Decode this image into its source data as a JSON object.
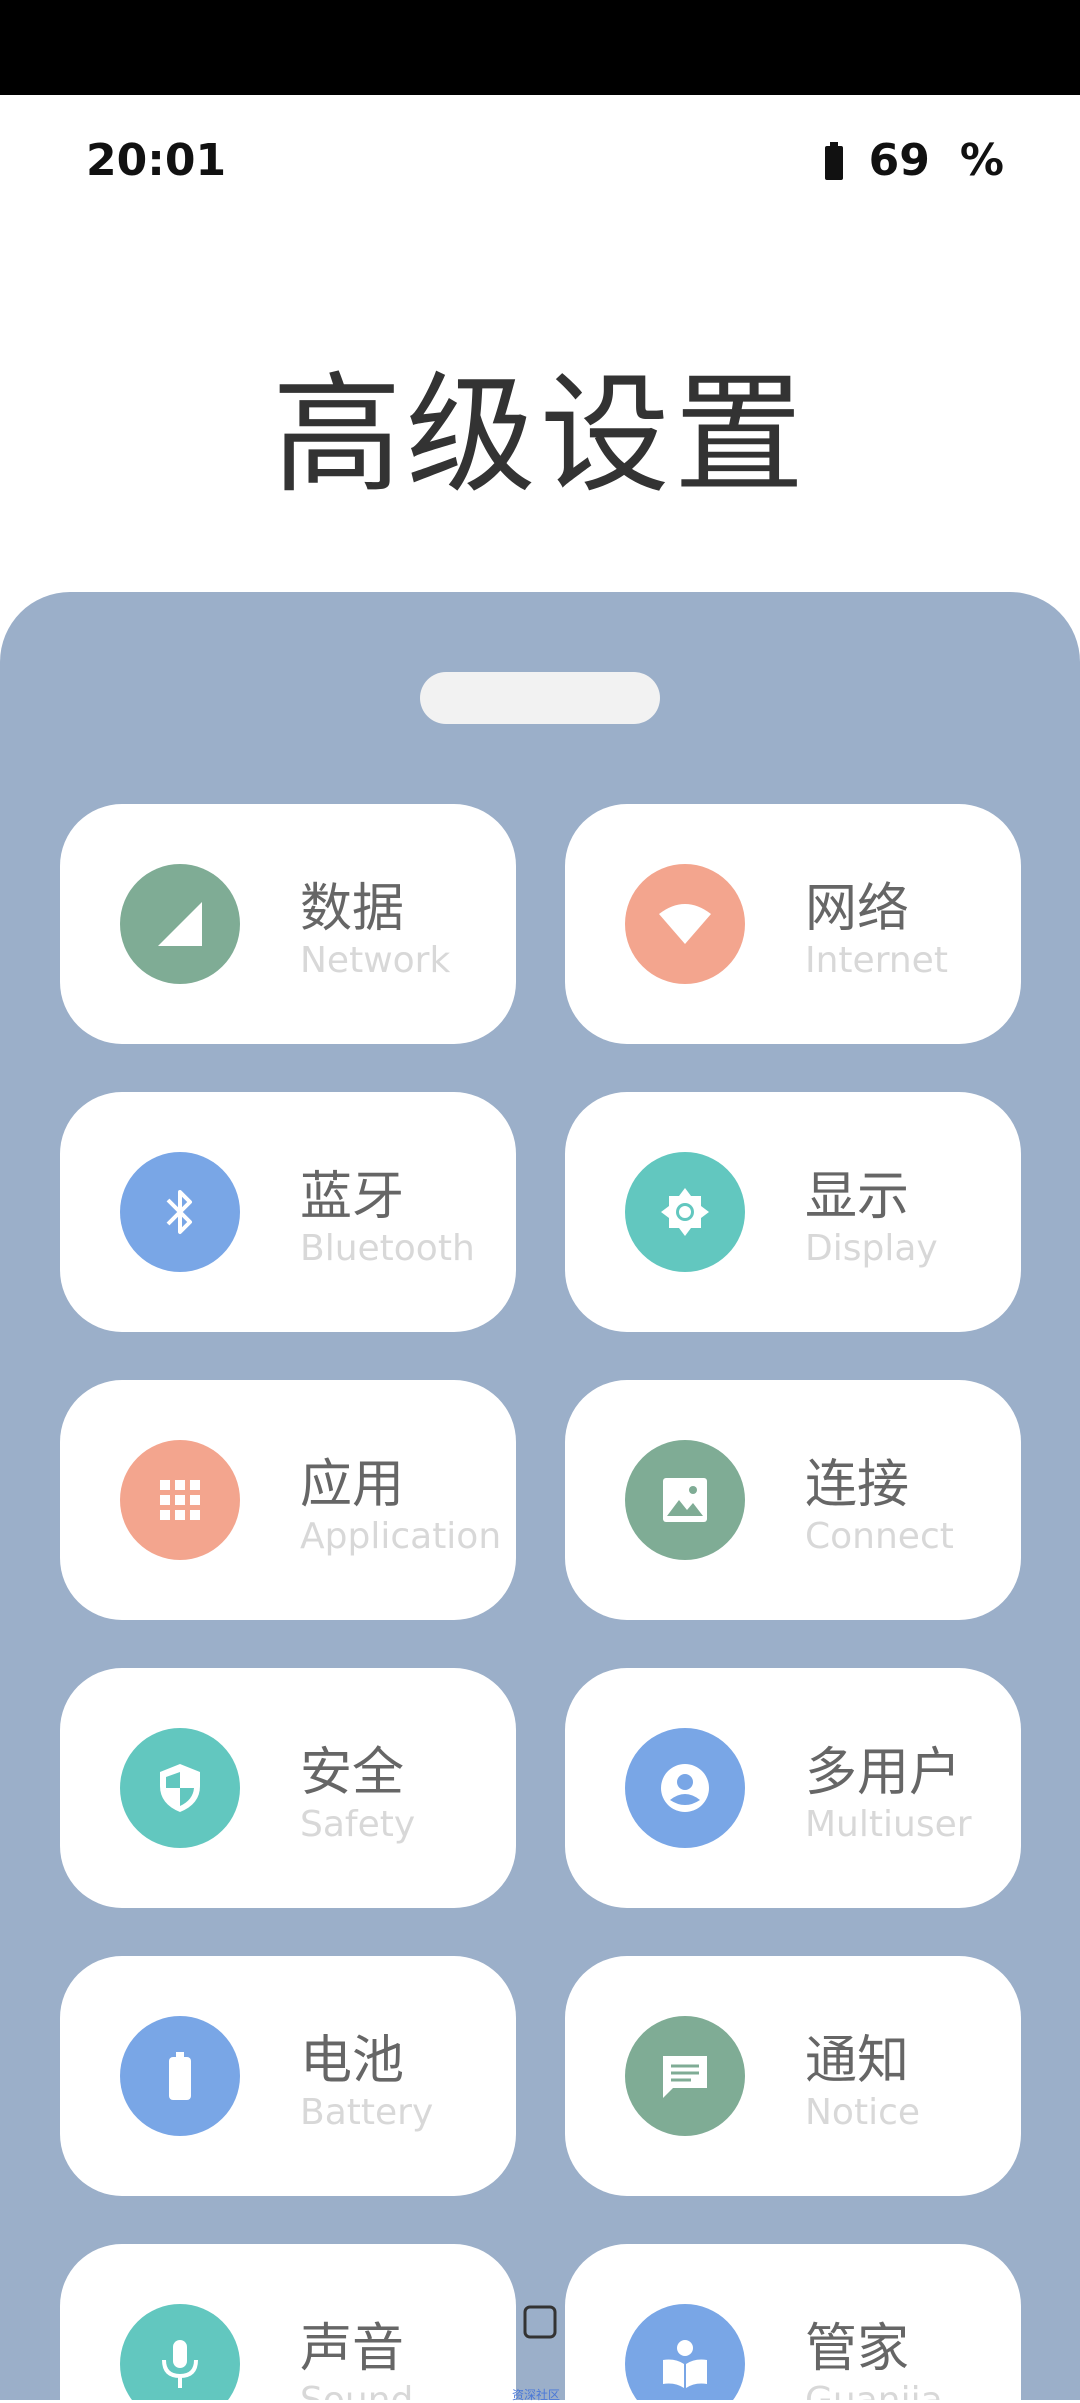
{
  "status_bar": {
    "time": "20:01",
    "battery_percent": "69",
    "percent_sign": "%"
  },
  "page": {
    "title": "高级设置"
  },
  "colors": {
    "panel": "#9bafc9",
    "green": "#7fac95",
    "salmon": "#f3a58e",
    "blue": "#79a6e6",
    "teal": "#62c7bf"
  },
  "cards": [
    {
      "cn": "数据",
      "en": "Network",
      "icon": "cellular-signal-icon",
      "color": "#7fac95"
    },
    {
      "cn": "网络",
      "en": "Internet",
      "icon": "wifi-icon",
      "color": "#f3a58e"
    },
    {
      "cn": "蓝牙",
      "en": "Bluetooth",
      "icon": "bluetooth-icon",
      "color": "#79a6e6"
    },
    {
      "cn": "显示",
      "en": "Display",
      "icon": "brightness-icon",
      "color": "#62c7bf"
    },
    {
      "cn": "应用",
      "en": "Application",
      "icon": "apps-grid-icon",
      "color": "#f3a58e"
    },
    {
      "cn": "连接",
      "en": "Connect",
      "icon": "image-icon",
      "color": "#7fac95"
    },
    {
      "cn": "安全",
      "en": "Safety",
      "icon": "shield-icon",
      "color": "#62c7bf"
    },
    {
      "cn": "多用户",
      "en": "Multiuser",
      "icon": "account-icon",
      "color": "#79a6e6"
    },
    {
      "cn": "电池",
      "en": "Battery",
      "icon": "battery-icon",
      "color": "#79a6e6"
    },
    {
      "cn": "通知",
      "en": "Notice",
      "icon": "message-icon",
      "color": "#7fac95"
    },
    {
      "cn": "声音",
      "en": "Sound",
      "icon": "microphone-icon",
      "color": "#62c7bf"
    },
    {
      "cn": "管家",
      "en": "Guanjia",
      "icon": "book-reader-icon",
      "color": "#79a6e6"
    }
  ],
  "nav": {
    "small_text": "资深社区"
  }
}
